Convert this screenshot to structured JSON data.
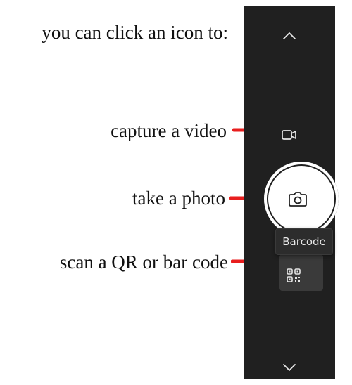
{
  "instructions": {
    "intro": "you can click an icon to:",
    "video": "capture a video",
    "photo": "take a photo",
    "scan": "scan a QR or bar code"
  },
  "camera_panel": {
    "tooltip": "Barcode",
    "icons": {
      "up": "chevron-up-icon",
      "video": "video-camera-icon",
      "photo": "camera-icon",
      "barcode": "qr-code-icon",
      "down": "chevron-down-icon"
    }
  },
  "colors": {
    "panel": "#202020",
    "arrow": "#e81e1e",
    "shutter": "#ffffff",
    "tooltip": "#2c2c2c",
    "barcode_button": "#3a3a3a"
  }
}
